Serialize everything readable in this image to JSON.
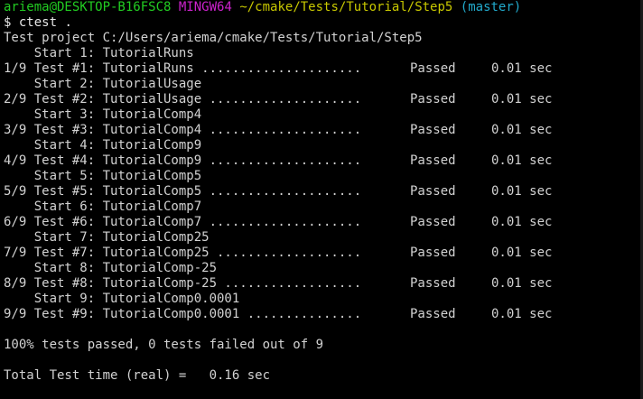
{
  "prompt": {
    "user_host": "ariema@DESKTOP-B16FSC8",
    "shell": "MINGW64",
    "path": "~/cmake/Tests/Tutorial/Step5",
    "branch": "(master)",
    "symbol": "$",
    "command": "ctest ."
  },
  "project_line": "Test project C:/Users/ariema/cmake/Tests/Tutorial/Step5",
  "tests": [
    {
      "start": "    Start 1: TutorialRuns",
      "result": "1/9 Test #1: TutorialRuns .....................",
      "status": "Passed",
      "time": "0.01 sec"
    },
    {
      "start": "    Start 2: TutorialUsage",
      "result": "2/9 Test #2: TutorialUsage ....................",
      "status": "Passed",
      "time": "0.01 sec"
    },
    {
      "start": "    Start 3: TutorialComp4",
      "result": "3/9 Test #3: TutorialComp4 ....................",
      "status": "Passed",
      "time": "0.01 sec"
    },
    {
      "start": "    Start 4: TutorialComp9",
      "result": "4/9 Test #4: TutorialComp9 ....................",
      "status": "Passed",
      "time": "0.01 sec"
    },
    {
      "start": "    Start 5: TutorialComp5",
      "result": "5/9 Test #5: TutorialComp5 ....................",
      "status": "Passed",
      "time": "0.01 sec"
    },
    {
      "start": "    Start 6: TutorialComp7",
      "result": "6/9 Test #6: TutorialComp7 ....................",
      "status": "Passed",
      "time": "0.01 sec"
    },
    {
      "start": "    Start 7: TutorialComp25",
      "result": "7/9 Test #7: TutorialComp25 ...................",
      "status": "Passed",
      "time": "0.01 sec"
    },
    {
      "start": "    Start 8: TutorialComp-25",
      "result": "8/9 Test #8: TutorialComp-25 ..................",
      "status": "Passed",
      "time": "0.01 sec"
    },
    {
      "start": "    Start 9: TutorialComp0.0001",
      "result": "9/9 Test #9: TutorialComp0.0001 ...............",
      "status": "Passed",
      "time": "0.01 sec"
    }
  ],
  "summary": "100% tests passed, 0 tests failed out of 9",
  "total_time": "Total Test time (real) =   0.16 sec",
  "colors": {
    "background": "#000000",
    "text": "#d2d2d2",
    "user_host": "#22cc22",
    "shell": "#cc22cc",
    "path": "#c8c800",
    "branch": "#22aacc"
  }
}
